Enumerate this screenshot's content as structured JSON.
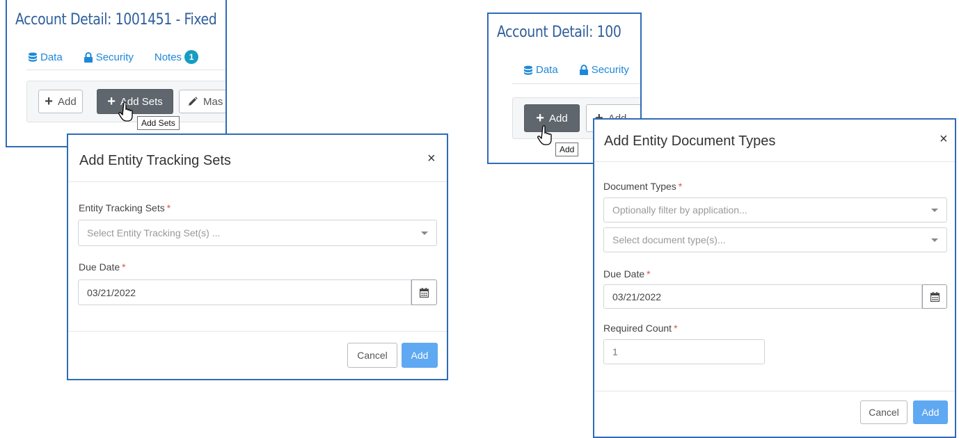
{
  "left_panel": {
    "title": "Account Detail: 1001451 - Fixed",
    "tabs": [
      {
        "label": "Data",
        "icon": "database-icon"
      },
      {
        "label": "Security",
        "icon": "lock-icon"
      },
      {
        "label": "Notes",
        "badge": "1"
      }
    ],
    "toolbar": {
      "add_label": "Add",
      "add_sets_label": "Add Sets",
      "mass_label": "Mas"
    },
    "tooltip": "Add Sets"
  },
  "right_panel": {
    "title": "Account Detail: 100",
    "tabs": [
      {
        "label": "Data",
        "icon": "database-icon"
      },
      {
        "label": "Security",
        "icon": "lock-icon"
      }
    ],
    "toolbar": {
      "add_label": "Add",
      "second_label": "Add"
    },
    "tooltip": "Add"
  },
  "modal_tracking_sets": {
    "title": "Add Entity Tracking Sets",
    "close": "×",
    "fields": {
      "sets_label": "Entity Tracking Sets",
      "sets_placeholder": "Select Entity Tracking Set(s) ...",
      "due_label": "Due Date",
      "due_value": "03/21/2022"
    },
    "required_mark": "*",
    "cancel_label": "Cancel",
    "add_label": "Add"
  },
  "modal_document_types": {
    "title": "Add Entity Document Types",
    "close": "×",
    "fields": {
      "doc_types_label": "Document Types",
      "filter_placeholder": "Optionally filter by application...",
      "doc_placeholder": "Select document type(s)...",
      "due_label": "Due Date",
      "due_value": "03/21/2022",
      "count_label": "Required Count",
      "count_value": "1"
    },
    "required_mark": "*",
    "cancel_label": "Cancel",
    "add_label": "Add"
  },
  "colors": {
    "frame_border": "#2e6bb8",
    "title_blue": "#2f5f9c",
    "link_blue": "#1e88d8",
    "badge": "#169dc2",
    "primary_button": "#5fa8f2",
    "dark_button": "#5f666d",
    "required": "#d9534f"
  }
}
